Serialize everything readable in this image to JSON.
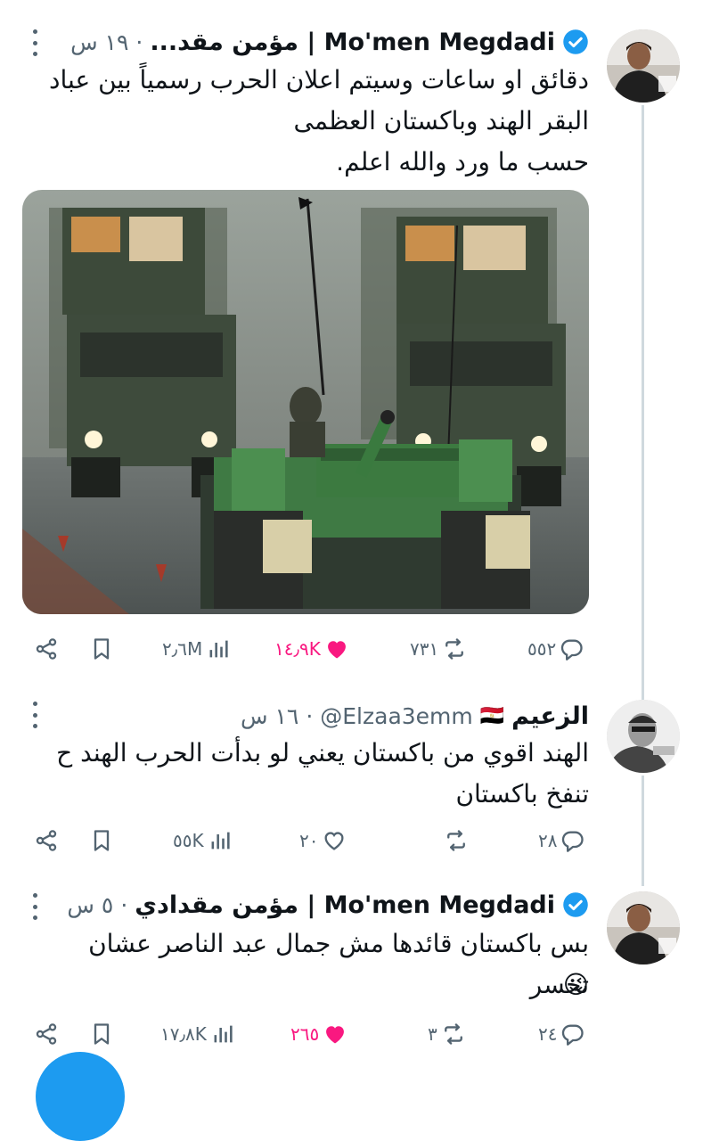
{
  "tweets": [
    {
      "name": "Mo'men Megdadi | مؤمن مقد...",
      "time": "١٩ س",
      "text": "دقائق او ساعات وسيتم اعلان الحرب رسمياً بين عباد\nالبقر الهند وباكستان العظمى\nحسب ما ورد والله اعلم.",
      "stats": {
        "replies": "٥٥٢",
        "retweets": "٧٣١",
        "likes": "١٤٫٩K",
        "views": "٢٫٦M"
      }
    },
    {
      "name": "الزعيم",
      "handle": "@Elzaa3emm",
      "flag": "🇪🇬",
      "time": "١٦ س",
      "text": "الهند اقوي من باكستان يعني لو بدأت الحرب الهند ح\nتنفخ باكستان",
      "stats": {
        "replies": "٢٨",
        "retweets": "",
        "likes": "٢٠",
        "views": "٥٥K"
      }
    },
    {
      "name": "Mo'men Megdadi | مؤمن مقدادي",
      "time": "٥ س",
      "text": "بس باكستان قائدها مش جمال عبد الناصر عشان تخسر",
      "emoji": "😉",
      "stats": {
        "replies": "٢٤",
        "retweets": "٣",
        "likes": "٢٦٥",
        "views": "١٧٫٨K"
      }
    }
  ],
  "colors": {
    "like_active": "#f91880",
    "verified": "#1d9bf0",
    "muted": "#536471"
  }
}
